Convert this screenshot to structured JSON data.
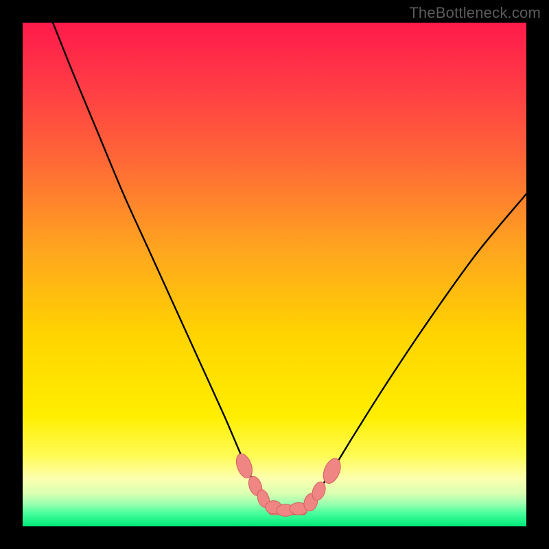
{
  "watermark": "TheBottleneck.com",
  "colors": {
    "frame": "#000000",
    "curve": "#000000",
    "marker_fill": "#ef8683",
    "marker_stroke": "#d2605f",
    "gradient_stops": [
      {
        "offset": 0.0,
        "color": "#ff1a4b"
      },
      {
        "offset": 0.12,
        "color": "#ff3a46"
      },
      {
        "offset": 0.28,
        "color": "#ff6a36"
      },
      {
        "offset": 0.45,
        "color": "#ffa51f"
      },
      {
        "offset": 0.62,
        "color": "#ffd400"
      },
      {
        "offset": 0.78,
        "color": "#ffee00"
      },
      {
        "offset": 0.86,
        "color": "#fffb55"
      },
      {
        "offset": 0.905,
        "color": "#fdffb0"
      },
      {
        "offset": 0.935,
        "color": "#d9ffb0"
      },
      {
        "offset": 0.955,
        "color": "#9cffb0"
      },
      {
        "offset": 0.975,
        "color": "#44ff9a"
      },
      {
        "offset": 1.0,
        "color": "#00e87a"
      }
    ]
  },
  "chart_data": {
    "type": "line",
    "title": "",
    "xlabel": "",
    "ylabel": "",
    "xlim": [
      0,
      100
    ],
    "ylim": [
      0,
      100
    ],
    "legend": false,
    "grid": false,
    "series": [
      {
        "name": "bottleneck-curve",
        "x": [
          6,
          10,
          15,
          20,
          25,
          30,
          35,
          40,
          43,
          45,
          47,
          49,
          51,
          53,
          55,
          57,
          59,
          62,
          66,
          72,
          80,
          90,
          100
        ],
        "values": [
          100,
          90,
          78,
          66,
          55,
          44,
          33,
          22,
          15,
          10.5,
          7,
          4.5,
          3.3,
          3,
          3.3,
          4.7,
          7.5,
          12,
          18.5,
          28,
          40,
          54,
          66
        ]
      }
    ],
    "markers": [
      {
        "x": 44.0,
        "y": 12.0,
        "rx": 1.4,
        "ry": 2.5,
        "rot": -20
      },
      {
        "x": 46.2,
        "y": 8.0,
        "rx": 1.2,
        "ry": 2.0,
        "rot": -20
      },
      {
        "x": 47.8,
        "y": 5.5,
        "rx": 1.1,
        "ry": 1.8,
        "rot": -18
      },
      {
        "x": 49.8,
        "y": 3.8,
        "rx": 1.6,
        "ry": 1.3,
        "rot": 0
      },
      {
        "x": 52.2,
        "y": 3.2,
        "rx": 1.8,
        "ry": 1.2,
        "rot": 0
      },
      {
        "x": 54.8,
        "y": 3.5,
        "rx": 1.8,
        "ry": 1.2,
        "rot": 0
      },
      {
        "x": 57.2,
        "y": 4.8,
        "rx": 1.3,
        "ry": 1.8,
        "rot": 18
      },
      {
        "x": 58.8,
        "y": 7.0,
        "rx": 1.2,
        "ry": 1.9,
        "rot": 20
      },
      {
        "x": 61.4,
        "y": 11.0,
        "rx": 1.5,
        "ry": 2.6,
        "rot": 22
      }
    ],
    "flat_segment": {
      "x0": 48.8,
      "x1": 56.4,
      "y": 3.1,
      "thickness": 1.6
    }
  }
}
